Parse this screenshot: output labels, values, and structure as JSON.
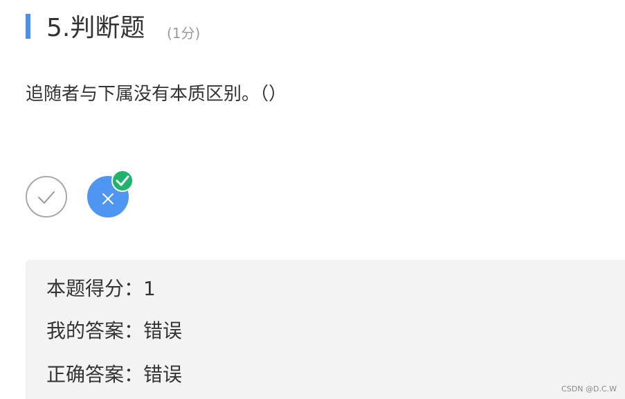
{
  "question": {
    "title": "5.判断题",
    "score_note": "(1分)",
    "text": "追随者与下属没有本质区别。（）"
  },
  "options": {
    "true_icon": "check-icon",
    "false_icon": "close-icon",
    "selected": "false",
    "correct_badge_icon": "check-icon"
  },
  "result": {
    "score_line": "本题得分：1",
    "my_answer_line": "我的答案：错误",
    "correct_answer_line": "正确答案：错误"
  },
  "watermark": "CSDN @D.C.W",
  "colors": {
    "accent": "#4a90f0",
    "selected_option": "#4f96f2",
    "correct_badge": "#1fb36b",
    "panel_bg": "#f3f3f3"
  }
}
